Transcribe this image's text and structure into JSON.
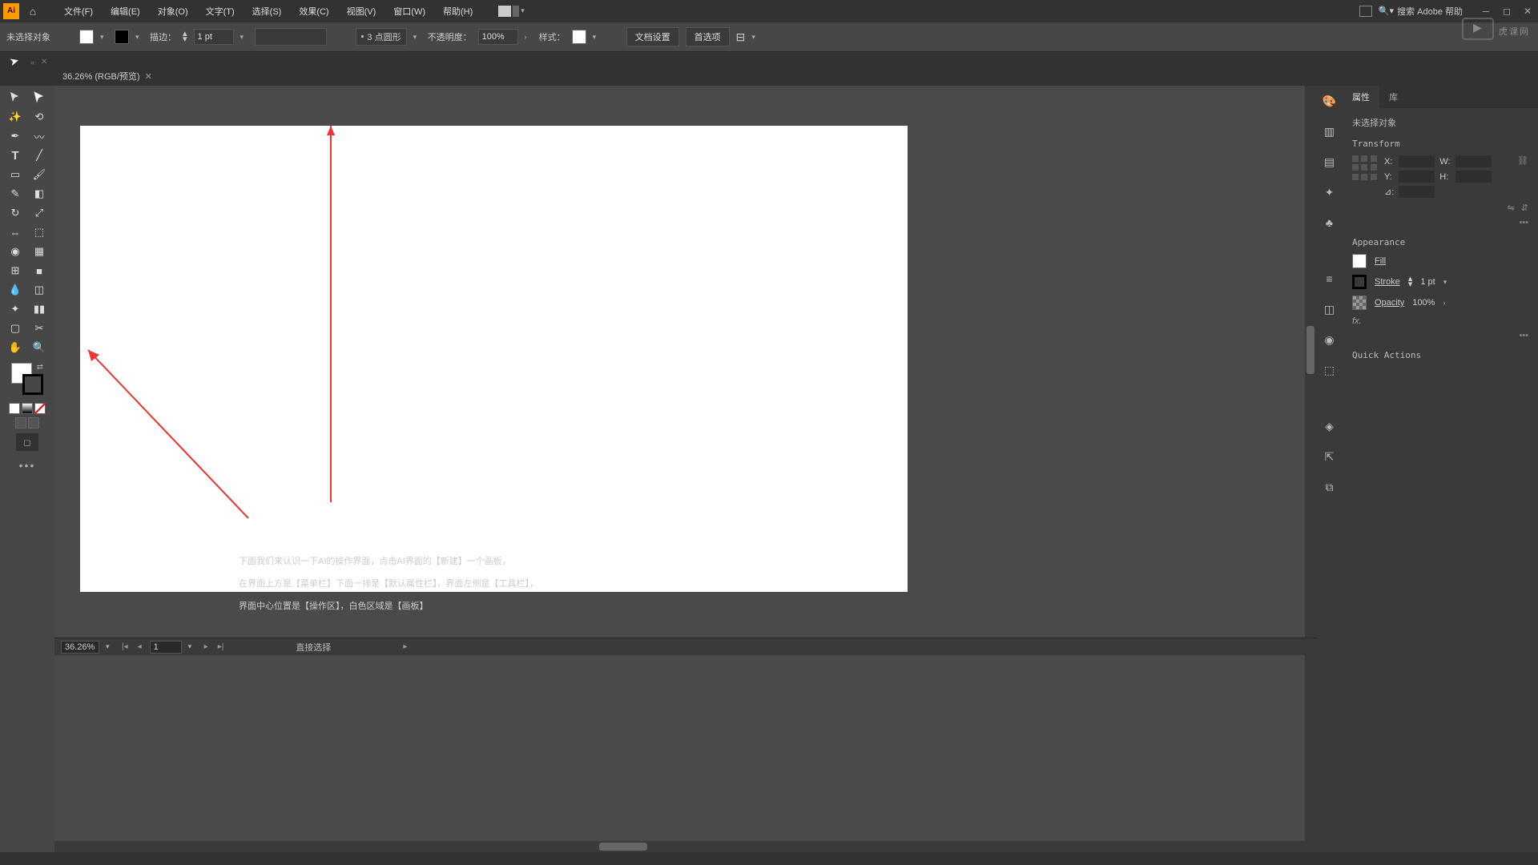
{
  "menubar": {
    "items": [
      "文件(F)",
      "编辑(E)",
      "对象(O)",
      "文字(T)",
      "选择(S)",
      "效果(C)",
      "视图(V)",
      "窗口(W)",
      "帮助(H)"
    ],
    "search_placeholder": "搜索 Adobe 帮助"
  },
  "controlbar": {
    "no_selection": "未选择对象",
    "stroke_label": "描边：",
    "stroke_value": "1 pt",
    "shape_label": "3 点圆形",
    "opacity_label": "不透明度：",
    "opacity_value": "100%",
    "style_label": "样式：",
    "doc_setup": "文档设置",
    "prefs": "首选项"
  },
  "document": {
    "tab_title": "36.26% (RGB/预览)"
  },
  "statusbar": {
    "zoom": "36.26%",
    "artboard_num": "1",
    "tool_hint": "直接选择"
  },
  "properties": {
    "tabs": [
      "属性",
      "库"
    ],
    "no_selection": "未选择对象",
    "transform_title": "Transform",
    "x_label": "X:",
    "y_label": "Y:",
    "w_label": "W:",
    "h_label": "H:",
    "angle_label": "⊿:",
    "appearance_title": "Appearance",
    "fill_label": "Fill",
    "stroke_label": "Stroke",
    "stroke_value": "1 pt",
    "opacity_label": "Opacity",
    "opacity_value": "100%",
    "fx_label": "fx.",
    "quick_actions": "Quick Actions"
  },
  "annotation": {
    "line1": "下面我们来认识一下AI的操作界面，点击AI界面的【新建】一个画板，",
    "line2": "在界面上方是【菜单栏】下面一排是【默认属性栏】，界面左侧是【工具栏】，",
    "line3": "界面中心位置是【操作区】，白色区域是【画板】"
  },
  "watermark": "虎课网"
}
